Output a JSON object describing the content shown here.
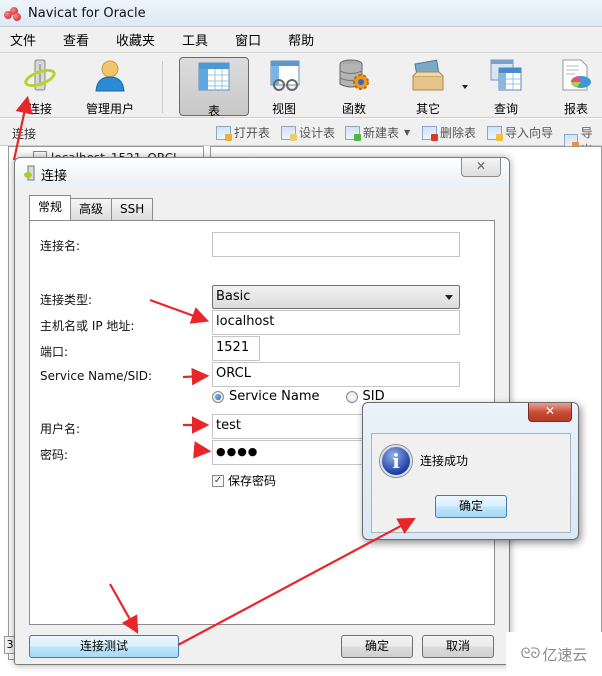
{
  "app": {
    "title": "Navicat for Oracle",
    "logo_icon": "navicat-logo-icon"
  },
  "menubar": {
    "items": [
      "文件",
      "查看",
      "收藏夹",
      "工具",
      "窗口",
      "帮助"
    ]
  },
  "toolbar": {
    "buttons": [
      {
        "label": "连接",
        "icon": "connection-icon"
      },
      {
        "label": "管理用户",
        "icon": "user-icon"
      },
      {
        "label": "表",
        "icon": "table-icon",
        "active": true
      },
      {
        "label": "视图",
        "icon": "view-icon"
      },
      {
        "label": "函数",
        "icon": "function-icon"
      },
      {
        "label": "其它",
        "icon": "other-icon",
        "has_dropdown": true
      },
      {
        "label": "查询",
        "icon": "query-icon"
      },
      {
        "label": "报表",
        "icon": "report-icon"
      }
    ]
  },
  "subtoolbar": {
    "section_label": "连接",
    "object_tools": [
      {
        "label": "打开表",
        "icon": "open-table-icon"
      },
      {
        "label": "设计表",
        "icon": "design-table-icon"
      },
      {
        "label": "新建表",
        "icon": "new-table-icon",
        "has_dropdown": true
      },
      {
        "label": "删除表",
        "icon": "delete-table-icon"
      },
      {
        "label": "导入向导",
        "icon": "import-wizard-icon"
      },
      {
        "label": "导出",
        "icon": "export-wizard-icon"
      }
    ]
  },
  "navigation": {
    "tree_items": [
      "localhost_1521_ORCL"
    ],
    "status_fragment": "3"
  },
  "connection_dialog": {
    "title": "连接",
    "close_symbol": "✕",
    "tabs": [
      {
        "label": "常规",
        "active": true
      },
      {
        "label": "高级",
        "active": false
      },
      {
        "label": "SSH",
        "active": false
      }
    ],
    "fields": {
      "connection_name": {
        "label": "连接名:",
        "value": ""
      },
      "connection_type": {
        "label": "连接类型:",
        "value": "Basic"
      },
      "host": {
        "label": "主机名或 IP 地址:",
        "value": "localhost"
      },
      "port": {
        "label": "端口:",
        "value": "1521"
      },
      "service_name": {
        "label": "Service Name/SID:",
        "value": "ORCL"
      },
      "service_type_options": [
        {
          "label": "Service Name",
          "selected": true
        },
        {
          "label": "SID",
          "selected": false
        }
      ],
      "username": {
        "label": "用户名:",
        "value": "test"
      },
      "password": {
        "label": "密码:",
        "value": "●●●●"
      },
      "save_password": {
        "label": "保存密码",
        "checked": true
      }
    },
    "buttons": {
      "test": "连接测试",
      "ok": "确定",
      "cancel": "取消"
    }
  },
  "message_box": {
    "close_symbol": "✕",
    "icon": "info-icon",
    "icon_glyph": "i",
    "text": "连接成功",
    "ok_button": "确定"
  },
  "annotations": {
    "arrow_color": "#e8262a"
  },
  "watermark": {
    "logo": "ᘓᘐ",
    "text": "亿速云"
  }
}
